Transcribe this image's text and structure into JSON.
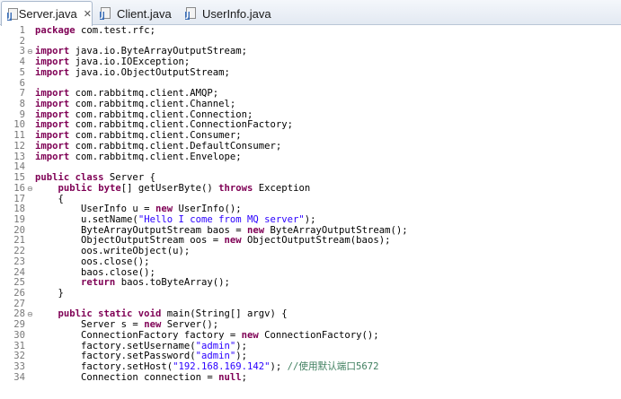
{
  "tabs": [
    {
      "label": "Server.java",
      "active": true,
      "close": "✕"
    },
    {
      "label": "Client.java",
      "active": false
    },
    {
      "label": "UserInfo.java",
      "active": false
    }
  ],
  "fold_icons": {
    "collapse": "⊖"
  },
  "lines": [
    {
      "n": "1",
      "fold": "",
      "tokens": [
        {
          "t": "package",
          "c": "kw"
        },
        {
          "t": " com.test.rfc;"
        }
      ]
    },
    {
      "n": "2",
      "fold": "",
      "tokens": []
    },
    {
      "n": "3",
      "fold": "⊖",
      "tokens": [
        {
          "t": "import",
          "c": "kw"
        },
        {
          "t": " java.io.ByteArrayOutputStream;"
        }
      ]
    },
    {
      "n": "4",
      "fold": "",
      "tokens": [
        {
          "t": "import",
          "c": "kw"
        },
        {
          "t": " java.io.IOException;"
        }
      ]
    },
    {
      "n": "5",
      "fold": "",
      "tokens": [
        {
          "t": "import",
          "c": "kw"
        },
        {
          "t": " java.io.ObjectOutputStream;"
        }
      ]
    },
    {
      "n": "6",
      "fold": "",
      "tokens": []
    },
    {
      "n": "7",
      "fold": "",
      "tokens": [
        {
          "t": "import",
          "c": "kw"
        },
        {
          "t": " com.rabbitmq.client.AMQP;"
        }
      ]
    },
    {
      "n": "8",
      "fold": "",
      "tokens": [
        {
          "t": "import",
          "c": "kw"
        },
        {
          "t": " com.rabbitmq.client.Channel;"
        }
      ]
    },
    {
      "n": "9",
      "fold": "",
      "tokens": [
        {
          "t": "import",
          "c": "kw"
        },
        {
          "t": " com.rabbitmq.client.Connection;"
        }
      ]
    },
    {
      "n": "10",
      "fold": "",
      "tokens": [
        {
          "t": "import",
          "c": "kw"
        },
        {
          "t": " com.rabbitmq.client.ConnectionFactory;"
        }
      ]
    },
    {
      "n": "11",
      "fold": "",
      "tokens": [
        {
          "t": "import",
          "c": "kw"
        },
        {
          "t": " com.rabbitmq.client.Consumer;"
        }
      ]
    },
    {
      "n": "12",
      "fold": "",
      "tokens": [
        {
          "t": "import",
          "c": "kw"
        },
        {
          "t": " com.rabbitmq.client.DefaultConsumer;"
        }
      ]
    },
    {
      "n": "13",
      "fold": "",
      "tokens": [
        {
          "t": "import",
          "c": "kw"
        },
        {
          "t": " com.rabbitmq.client.Envelope;"
        }
      ]
    },
    {
      "n": "14",
      "fold": "",
      "tokens": []
    },
    {
      "n": "15",
      "fold": "",
      "tokens": [
        {
          "t": "public class",
          "c": "kw"
        },
        {
          "t": " Server {"
        }
      ]
    },
    {
      "n": "16",
      "fold": "⊖",
      "tokens": [
        {
          "t": "    "
        },
        {
          "t": "public",
          "c": "kw"
        },
        {
          "t": " "
        },
        {
          "t": "byte",
          "c": "kw"
        },
        {
          "t": "[] getUserByte() "
        },
        {
          "t": "throws",
          "c": "kw"
        },
        {
          "t": " Exception"
        }
      ]
    },
    {
      "n": "17",
      "fold": "",
      "tokens": [
        {
          "t": "    {"
        }
      ]
    },
    {
      "n": "18",
      "fold": "",
      "tokens": [
        {
          "t": "        UserInfo u = "
        },
        {
          "t": "new",
          "c": "kw"
        },
        {
          "t": " UserInfo();"
        }
      ]
    },
    {
      "n": "19",
      "fold": "",
      "tokens": [
        {
          "t": "        u.setName("
        },
        {
          "t": "\"Hello I come from MQ server\"",
          "c": "str"
        },
        {
          "t": ");"
        }
      ]
    },
    {
      "n": "20",
      "fold": "",
      "tokens": [
        {
          "t": "        ByteArrayOutputStream baos = "
        },
        {
          "t": "new",
          "c": "kw"
        },
        {
          "t": " ByteArrayOutputStream();"
        }
      ]
    },
    {
      "n": "21",
      "fold": "",
      "tokens": [
        {
          "t": "        ObjectOutputStream oos = "
        },
        {
          "t": "new",
          "c": "kw"
        },
        {
          "t": " ObjectOutputStream(baos);"
        }
      ]
    },
    {
      "n": "22",
      "fold": "",
      "tokens": [
        {
          "t": "        oos.writeObject(u);"
        }
      ]
    },
    {
      "n": "23",
      "fold": "",
      "tokens": [
        {
          "t": "        oos.close();"
        }
      ]
    },
    {
      "n": "24",
      "fold": "",
      "tokens": [
        {
          "t": "        baos.close();"
        }
      ]
    },
    {
      "n": "25",
      "fold": "",
      "tokens": [
        {
          "t": "        "
        },
        {
          "t": "return",
          "c": "kw"
        },
        {
          "t": " baos.toByteArray();"
        }
      ]
    },
    {
      "n": "26",
      "fold": "",
      "tokens": [
        {
          "t": "    }"
        }
      ]
    },
    {
      "n": "27",
      "fold": "",
      "tokens": []
    },
    {
      "n": "28",
      "fold": "⊖",
      "tokens": [
        {
          "t": "    "
        },
        {
          "t": "public static void",
          "c": "kw"
        },
        {
          "t": " main(String[] argv) {"
        }
      ]
    },
    {
      "n": "29",
      "fold": "",
      "tokens": [
        {
          "t": "        Server s = "
        },
        {
          "t": "new",
          "c": "kw"
        },
        {
          "t": " Server();"
        }
      ]
    },
    {
      "n": "30",
      "fold": "",
      "tokens": [
        {
          "t": "        ConnectionFactory factory = "
        },
        {
          "t": "new",
          "c": "kw"
        },
        {
          "t": " ConnectionFactory();"
        }
      ]
    },
    {
      "n": "31",
      "fold": "",
      "tokens": [
        {
          "t": "        factory.setUsername("
        },
        {
          "t": "\"admin\"",
          "c": "str"
        },
        {
          "t": ");"
        }
      ]
    },
    {
      "n": "32",
      "fold": "",
      "tokens": [
        {
          "t": "        factory.setPassword("
        },
        {
          "t": "\"admin\"",
          "c": "str"
        },
        {
          "t": ");"
        }
      ]
    },
    {
      "n": "33",
      "fold": "",
      "tokens": [
        {
          "t": "        factory.setHost("
        },
        {
          "t": "\"192.168.169.142\"",
          "c": "str"
        },
        {
          "t": "); "
        },
        {
          "t": "//使用默认端口5672",
          "c": "cm"
        }
      ]
    },
    {
      "n": "34",
      "fold": "",
      "tokens": [
        {
          "t": "        Connection connection = "
        },
        {
          "t": "null",
          "c": "kw"
        },
        {
          "t": ";"
        }
      ]
    }
  ]
}
